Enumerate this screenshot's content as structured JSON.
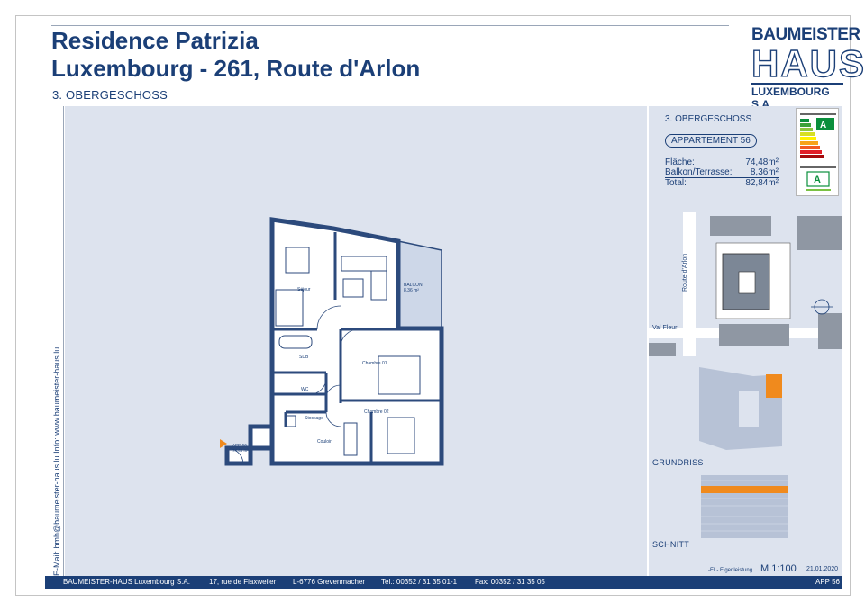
{
  "header": {
    "title_line1": "Residence Patrizia",
    "title_line2": "Luxembourg - 261, Route d'Arlon",
    "floor": "3. OBERGESCHOSS"
  },
  "logo": {
    "line1": "BAUMEISTER",
    "line2": "HAUS",
    "line3": "LUXEMBOURG S.A."
  },
  "sidebar": {
    "text": "E-Mail: bmh@baumeister-haus.lu    Info:    www.baumeister-haus.lu"
  },
  "info": {
    "floor": "3. OBERGESCHOSS",
    "apartment": "APPARTEMENT 56",
    "areas": [
      {
        "label": "Fläche:",
        "value": "74,48m²"
      },
      {
        "label": "Balkon/Terrasse:",
        "value": "8,36m²"
      },
      {
        "label": "Total:",
        "value": "82,84m²"
      }
    ],
    "energy_class": "A",
    "energy_class_2": "A"
  },
  "plan": {
    "rooms": {
      "sejour": "Séjour",
      "balcon": "BALCON",
      "balcon_area": "8,36 m²",
      "sdb": "SDB",
      "chambre1": "Chambre 01",
      "chambre2": "Chambre 02",
      "wc": "WC",
      "stockage": "Stockage",
      "couloir": "Couloir",
      "entry": "APP. 56",
      "entry_area": "74,48 m²"
    }
  },
  "map": {
    "street1": "Route d'Arlon",
    "street2": "Val Fleuri"
  },
  "labels": {
    "grundriss": "GRUNDRISS",
    "schnitt": "SCHNITT",
    "eigenleistung": "-EL- Eigenleistung",
    "scale": "M 1:100",
    "date": "21.01.2020"
  },
  "footer": {
    "company": "BAUMEISTER-HAUS Luxembourg S.A.",
    "street": "17, rue de Flaxweiler",
    "city": "L-6776 Grevenmacher",
    "tel": "Tel.: 00352 / 31 35 01-1",
    "fax": "Fax: 00352 / 31 35 05",
    "app": "APP 56"
  },
  "colors": {
    "brand": "#1b3f77",
    "panel": "#dde3ee",
    "highlight": "#f08a1d"
  }
}
